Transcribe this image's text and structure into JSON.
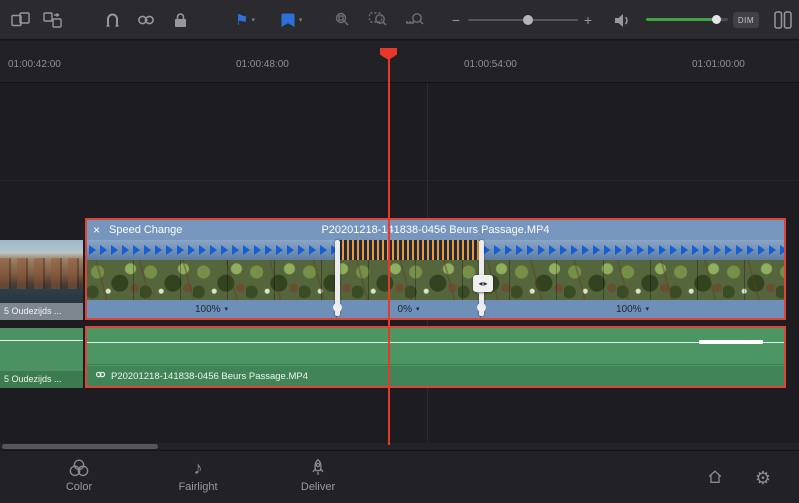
{
  "toolbar": {
    "dim_label": "DIM"
  },
  "icons": {
    "close": "×",
    "dropdown": "▾",
    "minus": "−",
    "plus": "+",
    "flag": "⚑",
    "music_note": "♪",
    "gear": "⚙",
    "trim_left": "◂",
    "trim_right": "▸"
  },
  "ruler": {
    "ticks": [
      "01:00:42:00",
      "01:00:48:00",
      "01:00:54:00",
      "01:01:00:00"
    ]
  },
  "tracks": {
    "video": {
      "left_clip": {
        "label": "5 Oudezijds ..."
      },
      "selected_clip": {
        "header_label": "Speed Change",
        "clip_name": "P20201218-141838-0456 Beurs Passage.MP4",
        "segments": [
          {
            "speed": "100%"
          },
          {
            "speed": "0%"
          },
          {
            "speed": "100%"
          }
        ]
      }
    },
    "audio": {
      "left_clip": {
        "label": "5 Oudezijds ..."
      },
      "selected_clip": {
        "clip_name": "P20201218-141838-0456 Beurs Passage.MP4"
      }
    }
  },
  "pages": [
    {
      "label": "Color"
    },
    {
      "label": "Fairlight"
    },
    {
      "label": "Deliver"
    }
  ],
  "colors": {
    "selection_red": "#e04438",
    "retime_arrow_blue": "#135fd8",
    "retime_orange": "#f09a2e",
    "audio_green": "#54a06b",
    "marker_blue": "#2f6fd8"
  }
}
